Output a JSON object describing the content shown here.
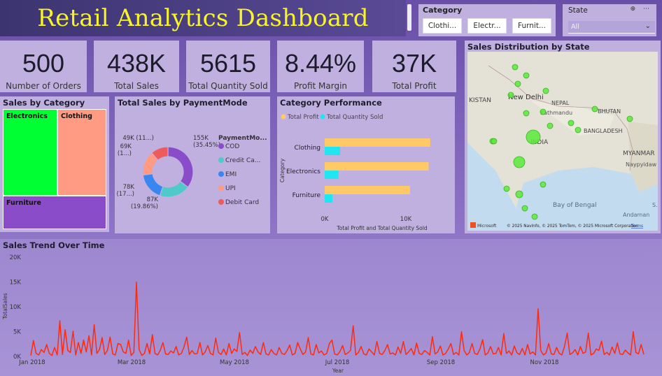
{
  "header": {
    "title": "Retail Analytics Dashboard"
  },
  "slicers": {
    "category": {
      "label": "Category",
      "chips": [
        "Clothi...",
        "Electr...",
        "Furnit..."
      ]
    },
    "state": {
      "label": "State",
      "selected": "All",
      "tools": "⊕ ⋯",
      "chevron": "⌄"
    }
  },
  "kpis": [
    {
      "value": "500",
      "label": "Number of Orders"
    },
    {
      "value": "438K",
      "label": "Total Sales"
    },
    {
      "value": "5615",
      "label": "Total Quantity Sold"
    },
    {
      "value": "8.44%",
      "label": "Profit Margin"
    },
    {
      "value": "37K",
      "label": "Total Profit"
    }
  ],
  "sales_by_category": {
    "title": "Sales by Category",
    "cells": [
      {
        "label": "Electronics",
        "color": "#00ff33"
      },
      {
        "label": "Clothing",
        "color": "#ff9b82"
      },
      {
        "label": "Furniture",
        "color": "#8a4cc8"
      }
    ]
  },
  "payment_mode": {
    "title": "Total Sales by PaymentMode",
    "legend_title": "PaymentMo...",
    "legend": [
      {
        "name": "COD",
        "color": "#8a4cc8"
      },
      {
        "name": "Credit Ca...",
        "color": "#4fc9c9"
      },
      {
        "name": "EMI",
        "color": "#3a86f0"
      },
      {
        "name": "UPI",
        "color": "#ff9b82"
      },
      {
        "name": "Debit Card",
        "color": "#ef5a5a"
      }
    ],
    "data_labels": [
      {
        "line1": "155K",
        "line2": "(35.45%)"
      },
      {
        "line1": "87K",
        "line2": "(19.86%)"
      },
      {
        "line1": "78K",
        "line2": "(17...)"
      },
      {
        "line1": "69K",
        "line2": "(1...)"
      },
      {
        "line1": "49K (11...)",
        "line2": ""
      }
    ]
  },
  "category_performance": {
    "title": "Category Performance",
    "legend": [
      {
        "name": "Total Profit",
        "color": "#ffc966"
      },
      {
        "name": "Total Quantity Sold",
        "color": "#1fe6f0"
      }
    ],
    "y_title": "Category",
    "x_title": "Total Profit and Total Quantity Sold",
    "x_ticks": [
      "0K",
      "10K"
    ]
  },
  "map": {
    "title": "Sales Distribution by State",
    "places": [
      "KISTAN",
      "New Delhi",
      "NEPAL",
      "Kathmandu",
      "BHUTAN",
      "BANGLADESH",
      "INDIA",
      "MYANMAR",
      "Naypyidaw",
      "Bay of Bengal",
      "Andaman",
      "S..."
    ],
    "attribution": "© 2025 NavInfo, © 2025 TomTom, © 2025 Microsoft Corporation",
    "terms": "Terms",
    "ms_logo": "Microsoft"
  },
  "trend": {
    "title": "Sales Trend Over Time",
    "y_title": "TotalSales",
    "x_title": "Year",
    "y_ticks": [
      "0K",
      "5K",
      "10K",
      "15K",
      "20K"
    ],
    "x_ticks": [
      "Jan 2018",
      "Mar 2018",
      "May 2018",
      "Jul 2018",
      "Sep 2018",
      "Nov 2018"
    ]
  },
  "chart_data": [
    {
      "type": "pie",
      "title": "Total Sales by PaymentMode",
      "categories": [
        "COD",
        "Credit Ca...",
        "EMI",
        "UPI",
        "Debit Card"
      ],
      "values": [
        155,
        87,
        78,
        69,
        49
      ],
      "colors": [
        "#8a4cc8",
        "#4fc9c9",
        "#3a86f0",
        "#ff9b82",
        "#ef5a5a"
      ]
    },
    {
      "type": "bar",
      "title": "Category Performance",
      "categories": [
        "Clothing",
        "Electronics",
        "Furniture"
      ],
      "series": [
        {
          "name": "Total Profit",
          "values": [
            13000,
            12800,
            10500
          ]
        },
        {
          "name": "Total Quantity Sold",
          "values": [
            1900,
            1700,
            950
          ]
        }
      ],
      "xlim": [
        0,
        20000
      ]
    },
    {
      "type": "line",
      "title": "Sales Trend Over Time",
      "ylabel": "TotalSales",
      "xlabel": "Year",
      "ylim": [
        0,
        20000
      ],
      "x_range": [
        "2018-01-01",
        "2018-12-31"
      ],
      "values": [
        200,
        3200,
        600,
        300,
        1400,
        800,
        2400,
        600,
        200,
        1800,
        300,
        7200,
        400,
        5400,
        1200,
        800,
        5100,
        300,
        2800,
        600,
        3300,
        900,
        4200,
        300,
        6400,
        600,
        1400,
        3800,
        400,
        1200,
        3900,
        500,
        300,
        2600,
        2400,
        900,
        600,
        3300,
        200,
        800,
        15000,
        1400,
        200,
        600,
        2600,
        500,
        4400,
        600,
        300,
        1200,
        2800,
        500,
        400,
        1100,
        700,
        2000,
        300,
        600,
        1900,
        3900,
        400,
        1200,
        500,
        600,
        2800,
        300,
        900,
        2200,
        600,
        300,
        3700,
        800,
        400,
        1500,
        300,
        2600,
        600,
        1500,
        1000,
        4800,
        400,
        800,
        200,
        1300,
        600,
        2000,
        900,
        400,
        2800,
        500,
        300,
        1400,
        600,
        300,
        1800,
        600,
        400,
        1200,
        2300,
        300,
        600,
        2800,
        1500,
        400,
        900,
        3800,
        500,
        300,
        2400,
        700,
        1100,
        300,
        600,
        2600,
        3300,
        500,
        300,
        1000,
        2200,
        400,
        700,
        1200,
        6200,
        300,
        800,
        2000,
        500,
        300,
        1500,
        900,
        300,
        3000,
        600,
        400,
        1200,
        2400,
        500,
        700,
        300,
        1900,
        600,
        3000,
        400,
        900,
        1600,
        300,
        2700,
        600,
        400,
        1200,
        800,
        300,
        4000,
        500,
        900,
        2100,
        300,
        600,
        1500,
        2600,
        400,
        800,
        300,
        5000,
        1200,
        300,
        800,
        2600,
        600,
        400,
        1500,
        3400,
        300,
        700,
        2000,
        500,
        600,
        1800,
        300,
        4600,
        600,
        1100,
        300,
        2100,
        700,
        400,
        1600,
        300,
        2400,
        500,
        900,
        300,
        9600,
        1200,
        300,
        700,
        2600,
        500,
        400,
        1800,
        600,
        300,
        2000,
        4700,
        400,
        700,
        1400,
        300,
        2000,
        600,
        900,
        4700,
        300,
        600,
        1500,
        1200,
        3100,
        400,
        800,
        300,
        1900,
        600,
        2700,
        500,
        400,
        1300,
        700,
        300,
        5000,
        800,
        500,
        2400,
        400
      ]
    }
  ]
}
